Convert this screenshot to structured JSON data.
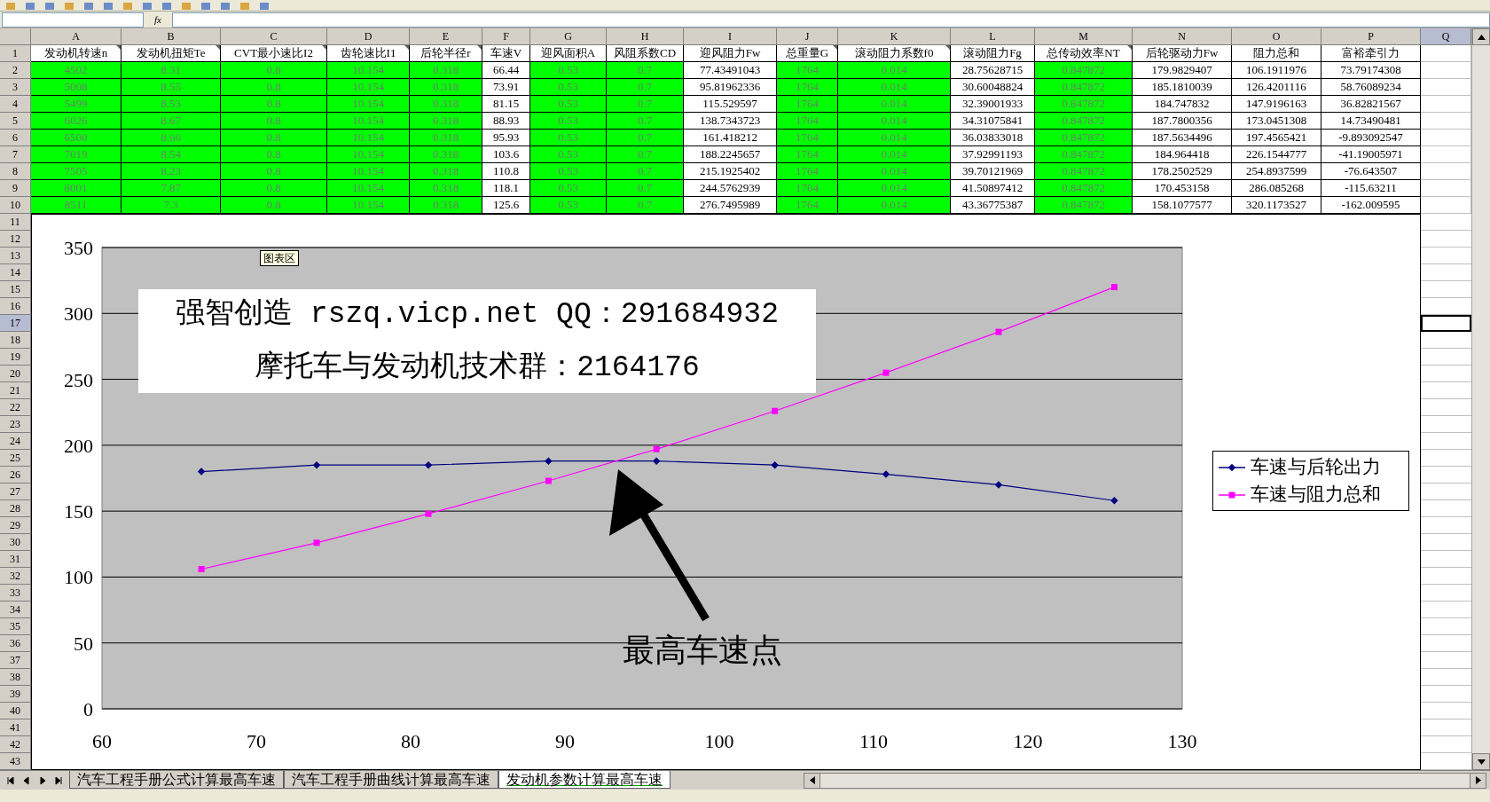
{
  "formula_bar": {
    "fx_label": "fx"
  },
  "columns": [
    {
      "label": "A",
      "header": "发动机转速n",
      "highlighted": true,
      "comment": true,
      "selected": false
    },
    {
      "label": "B",
      "header": "发动机扭矩Te",
      "highlighted": true,
      "comment": true,
      "selected": false
    },
    {
      "label": "C",
      "header": "CVT最小速比I2",
      "highlighted": true,
      "comment": true,
      "selected": false
    },
    {
      "label": "D",
      "header": "齿轮速比I1",
      "highlighted": true,
      "comment": true,
      "selected": false
    },
    {
      "label": "E",
      "header": "后轮半径r",
      "highlighted": true,
      "comment": true,
      "selected": false
    },
    {
      "label": "F",
      "header": "车速V",
      "highlighted": false,
      "comment": false,
      "selected": false
    },
    {
      "label": "G",
      "header": "迎风面积A",
      "highlighted": true,
      "comment": false,
      "selected": false
    },
    {
      "label": "H",
      "header": "风阻系数CD",
      "highlighted": true,
      "comment": false,
      "selected": false
    },
    {
      "label": "I",
      "header": "迎风阻力Fw",
      "highlighted": false,
      "comment": false,
      "selected": false
    },
    {
      "label": "J",
      "header": "总重量G",
      "highlighted": true,
      "comment": true,
      "selected": false
    },
    {
      "label": "K",
      "header": "滚动阻力系数f0",
      "highlighted": true,
      "comment": true,
      "selected": false
    },
    {
      "label": "L",
      "header": "滚动阻力Fg",
      "highlighted": false,
      "comment": false,
      "selected": false
    },
    {
      "label": "M",
      "header": "总传动效率NT",
      "highlighted": true,
      "comment": true,
      "selected": false
    },
    {
      "label": "N",
      "header": "后轮驱动力Fw",
      "highlighted": false,
      "comment": false,
      "selected": false
    },
    {
      "label": "O",
      "header": "阻力总和",
      "highlighted": false,
      "comment": false,
      "selected": false
    },
    {
      "label": "P",
      "header": "富裕牵引力",
      "highlighted": false,
      "comment": false,
      "selected": false
    },
    {
      "label": "Q",
      "selected": true
    }
  ],
  "header_row": {
    "label": "1",
    "selected": false
  },
  "rows": [
    {
      "label": "2",
      "selected": false,
      "cells": [
        "4502",
        "8.31",
        "0.8",
        "10.154",
        "0.318",
        "66.44",
        "0.53",
        "0.7",
        "77.43491043",
        "1764",
        "0.014",
        "28.75628715",
        "0.847872",
        "179.9829407",
        "106.1911976",
        "73.79174308"
      ]
    },
    {
      "label": "3",
      "selected": false,
      "cells": [
        "5008",
        "8.55",
        "0.8",
        "10.154",
        "0.318",
        "73.91",
        "0.53",
        "0.7",
        "95.81962336",
        "1764",
        "0.014",
        "30.60048824",
        "0.847872",
        "185.1810039",
        "126.4201116",
        "58.76089234"
      ]
    },
    {
      "label": "4",
      "selected": false,
      "cells": [
        "5499",
        "8.53",
        "0.8",
        "10.154",
        "0.318",
        "81.15",
        "0.53",
        "0.7",
        "115.529597",
        "1764",
        "0.014",
        "32.39001933",
        "0.847872",
        "184.747832",
        "147.9196163",
        "36.82821567"
      ]
    },
    {
      "label": "5",
      "selected": false,
      "cells": [
        "6026",
        "8.67",
        "0.8",
        "10.154",
        "0.318",
        "88.93",
        "0.53",
        "0.7",
        "138.7343723",
        "1764",
        "0.014",
        "34.31075841",
        "0.847872",
        "187.7800356",
        "173.0451308",
        "14.73490481"
      ]
    },
    {
      "label": "6",
      "selected": false,
      "cells": [
        "6500",
        "8.66",
        "0.8",
        "10.154",
        "0.318",
        "95.93",
        "0.53",
        "0.7",
        "161.418212",
        "1764",
        "0.014",
        "36.03833018",
        "0.847872",
        "187.5634496",
        "197.4565421",
        "-9.893092547"
      ]
    },
    {
      "label": "7",
      "selected": false,
      "cells": [
        "7019",
        "8.54",
        "0.8",
        "10.154",
        "0.318",
        "103.6",
        "0.53",
        "0.7",
        "188.2245657",
        "1764",
        "0.014",
        "37.92991193",
        "0.847872",
        "184.964418",
        "226.1544777",
        "-41.19005971"
      ]
    },
    {
      "label": "8",
      "selected": false,
      "cells": [
        "7505",
        "8.23",
        "0.8",
        "10.154",
        "0.318",
        "110.8",
        "0.53",
        "0.7",
        "215.1925402",
        "1764",
        "0.014",
        "39.70121969",
        "0.847872",
        "178.2502529",
        "254.8937599",
        "-76.643507"
      ]
    },
    {
      "label": "9",
      "selected": false,
      "cells": [
        "8001",
        "7.87",
        "0.8",
        "10.154",
        "0.318",
        "118.1",
        "0.53",
        "0.7",
        "244.5762939",
        "1764",
        "0.014",
        "41.50897412",
        "0.847872",
        "170.453158",
        "286.085268",
        "-115.63211"
      ]
    },
    {
      "label": "10",
      "selected": false,
      "cells": [
        "8511",
        "7.3",
        "0.8",
        "10.154",
        "0.318",
        "125.6",
        "0.53",
        "0.7",
        "276.7495989",
        "1764",
        "0.014",
        "43.36775387",
        "0.847872",
        "158.1077577",
        "320.1173527",
        "-162.009595"
      ]
    }
  ],
  "lower_rows": [
    {
      "label": "11",
      "selected": false
    },
    {
      "label": "12",
      "selected": false
    },
    {
      "label": "13",
      "selected": false
    },
    {
      "label": "14",
      "selected": false
    },
    {
      "label": "15",
      "selected": false
    },
    {
      "label": "16",
      "selected": false
    },
    {
      "label": "17",
      "selected": true
    },
    {
      "label": "18",
      "selected": false
    },
    {
      "label": "19",
      "selected": false
    },
    {
      "label": "20",
      "selected": false
    },
    {
      "label": "21",
      "selected": false
    },
    {
      "label": "22",
      "selected": false
    },
    {
      "label": "23",
      "selected": false
    },
    {
      "label": "24",
      "selected": false
    },
    {
      "label": "25",
      "selected": false
    },
    {
      "label": "26",
      "selected": false
    },
    {
      "label": "27",
      "selected": false
    },
    {
      "label": "28",
      "selected": false
    },
    {
      "label": "29",
      "selected": false
    },
    {
      "label": "30",
      "selected": false
    },
    {
      "label": "31",
      "selected": false
    },
    {
      "label": "32",
      "selected": false
    },
    {
      "label": "33",
      "selected": false
    },
    {
      "label": "34",
      "selected": false
    },
    {
      "label": "35",
      "selected": false
    },
    {
      "label": "36",
      "selected": false
    },
    {
      "label": "37",
      "selected": false
    },
    {
      "label": "38",
      "selected": false
    },
    {
      "label": "39",
      "selected": false
    },
    {
      "label": "40",
      "selected": false
    },
    {
      "label": "41",
      "selected": false
    },
    {
      "label": "42",
      "selected": false
    },
    {
      "label": "43",
      "selected": false
    }
  ],
  "chart": {
    "tooltip": "图表区",
    "banner_lines": [
      "强智创造 rszq.vicp.net QQ：291684932",
      "摩托车与发动机技术群：2164176"
    ],
    "callout": "最高车速点",
    "chart_data": {
      "type": "line",
      "x": [
        66.44,
        73.91,
        81.15,
        88.93,
        95.93,
        103.6,
        110.8,
        118.1,
        125.6
      ],
      "series": [
        {
          "name": "车速与后轮出力",
          "color": "#000080",
          "marker": "diamond",
          "values": [
            180,
            185,
            185,
            188,
            188,
            185,
            178,
            170,
            158
          ]
        },
        {
          "name": "车速与阻力总和",
          "color": "#ff00ff",
          "marker": "square",
          "values": [
            106,
            126,
            148,
            173,
            197,
            226,
            255,
            286,
            320
          ]
        }
      ],
      "grid": true,
      "xlim": [
        60,
        130
      ],
      "ylim": [
        0,
        350
      ],
      "xticks": [
        60,
        70,
        80,
        90,
        100,
        110,
        120,
        130
      ],
      "yticks": [
        0,
        50,
        100,
        150,
        200,
        250,
        300,
        350
      ]
    }
  },
  "sheet_tabs": [
    {
      "label": "汽车工程手册公式计算最高车速",
      "selected": false
    },
    {
      "label": "汽车工程手册曲线计算最高车速",
      "selected": false
    },
    {
      "label": "发动机参数计算最高车速",
      "selected": true
    }
  ]
}
